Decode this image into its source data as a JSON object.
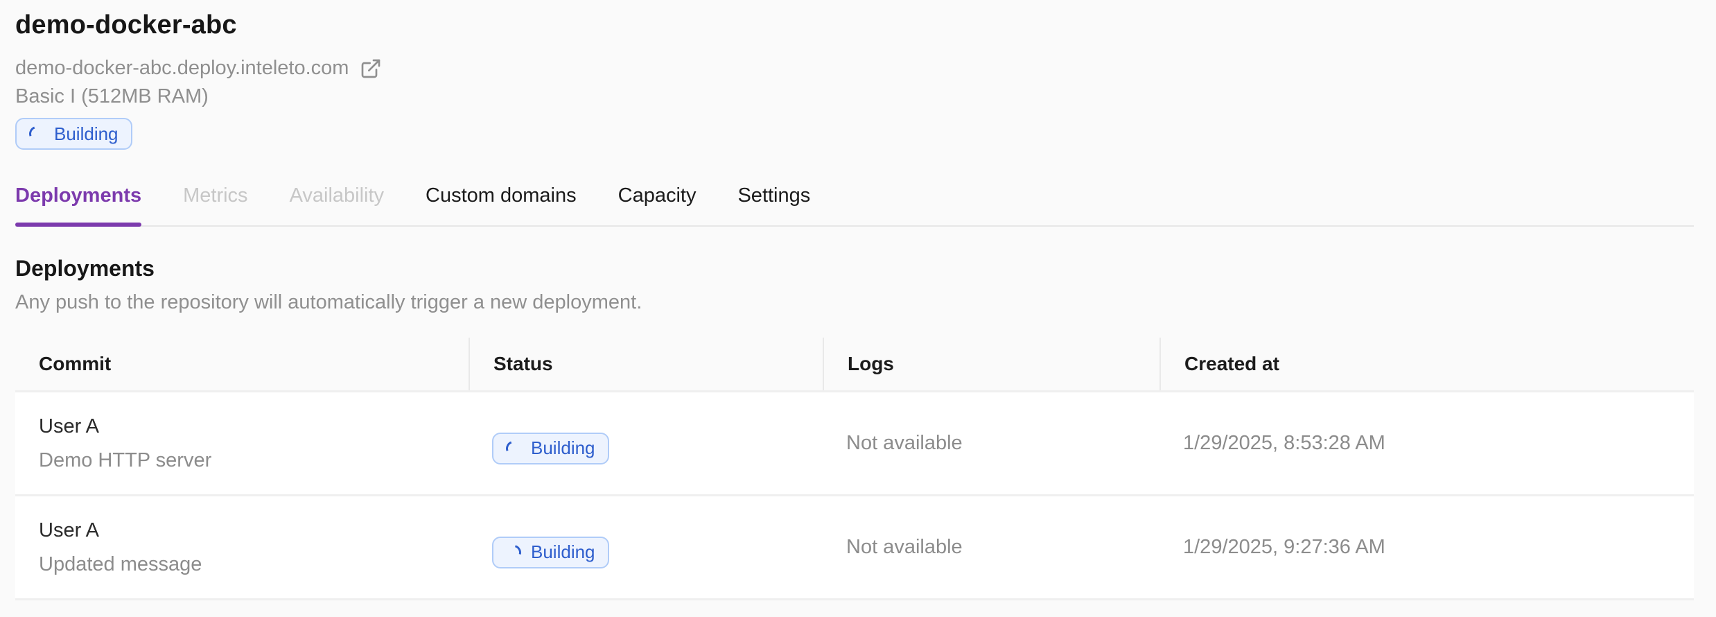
{
  "app": {
    "title": "demo-docker-abc",
    "url": "demo-docker-abc.deploy.inteleto.com",
    "plan": "Basic I (512MB RAM)",
    "status": "Building"
  },
  "colors": {
    "accent_purple": "#7c3aad",
    "badge_text": "#2e5ecd",
    "badge_bg": "#edf3fe",
    "badge_border": "#b0ccf8",
    "page_bg": "#fafafa",
    "secondary_text": "#8f8f8f"
  },
  "icons": {
    "external_link": "external-link-icon",
    "spinner": "spinner-icon"
  },
  "tabs": [
    {
      "label": "Deployments",
      "state": "active"
    },
    {
      "label": "Metrics",
      "state": "disabled"
    },
    {
      "label": "Availability",
      "state": "disabled"
    },
    {
      "label": "Custom domains",
      "state": "normal"
    },
    {
      "label": "Capacity",
      "state": "normal"
    },
    {
      "label": "Settings",
      "state": "normal"
    }
  ],
  "section": {
    "title": "Deployments",
    "description": "Any push to the repository will automatically trigger a new deployment."
  },
  "table": {
    "columns": [
      "Commit",
      "Status",
      "Logs",
      "Created at"
    ],
    "rows": [
      {
        "author": "User A",
        "message": "Demo HTTP server",
        "status": "Building",
        "logs": "Not available",
        "created_at": "1/29/2025, 8:53:28 AM"
      },
      {
        "author": "User A",
        "message": "Updated message",
        "status": "Building",
        "logs": "Not available",
        "created_at": "1/29/2025, 9:27:36 AM"
      }
    ]
  }
}
